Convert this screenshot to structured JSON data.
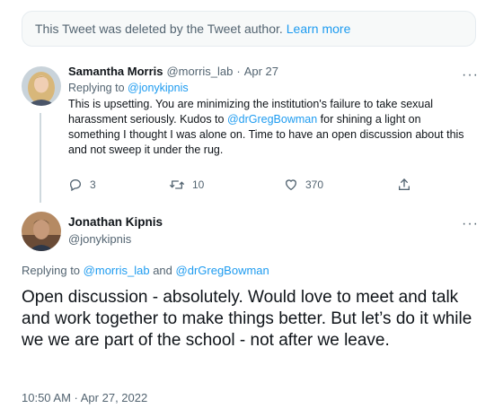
{
  "deleted_notice": {
    "text": "This Tweet was deleted by the Tweet author.",
    "learn_more": "Learn more"
  },
  "reply_tweet": {
    "name": "Samantha Morris",
    "handle": "@morris_lab",
    "separator": "·",
    "date": "Apr 27",
    "replying_prefix": "Replying to",
    "replying_to": "@jonykipnis",
    "body_part1": "This is upsetting. You are minimizing the institution's failure to take sexual harassment seriously. Kudos to",
    "body_mention": "@drGregBowman",
    "body_part2": "for shining a light on something I thought I was alone on. Time to have an open discussion about this and not sweep it under the rug.",
    "more": "···",
    "actions": {
      "replies": "3",
      "retweets": "10",
      "likes": "370"
    }
  },
  "main_tweet": {
    "name": "Jonathan Kipnis",
    "handle": "@jonykipnis",
    "more": "···",
    "replying_prefix": "Replying to",
    "mention1": "@morris_lab",
    "and": "and",
    "mention2": "@drGregBowman",
    "text": "Open discussion - absolutely. Would love to meet and talk and work together to make things better. But let’s do it while we we are part of the school - not after we leave.",
    "timestamp": "10:50 AM · Apr 27, 2022"
  },
  "colors": {
    "link": "#1d9bf0",
    "muted": "#536471",
    "text": "#0f1419"
  }
}
